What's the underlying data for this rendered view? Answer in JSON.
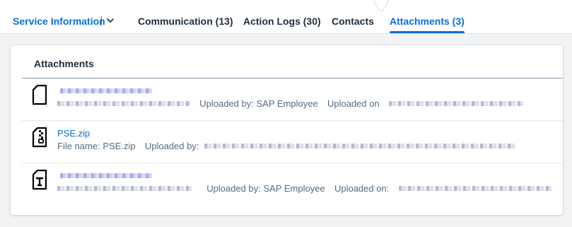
{
  "tabs": [
    {
      "label": "Service Information",
      "active": false
    },
    {
      "label": "Communication (13)",
      "active": false
    },
    {
      "label": "Action Logs (30)",
      "active": false
    },
    {
      "label": "Contacts",
      "active": false
    },
    {
      "label": "Attachments (3)",
      "active": true
    }
  ],
  "colors": {
    "accent": "#0a6ed1",
    "text": "#1d2d3e",
    "muted": "#556b82",
    "background": "#f2f3f4"
  },
  "icons": {
    "dropdown": "chevron-down-icon",
    "document": "document-icon",
    "zip": "zip-file-icon",
    "text_file": "text-file-icon"
  },
  "attachments": {
    "title": "Attachments",
    "items": [
      {
        "name": "",
        "file_name_label": "",
        "uploaded_by_label": "Uploaded by:",
        "uploaded_by": "SAP Employee",
        "uploaded_on_label": "Uploaded on"
      },
      {
        "name": "PSE.zip",
        "file_name_label": "File name:",
        "file_name": "PSE.zip",
        "uploaded_by_label": "Uploaded by:",
        "uploaded_by": ""
      },
      {
        "name": "",
        "uploaded_by_label": "Uploaded by:",
        "uploaded_by": "SAP Employee",
        "uploaded_on_label": "Uploaded on:"
      }
    ]
  }
}
